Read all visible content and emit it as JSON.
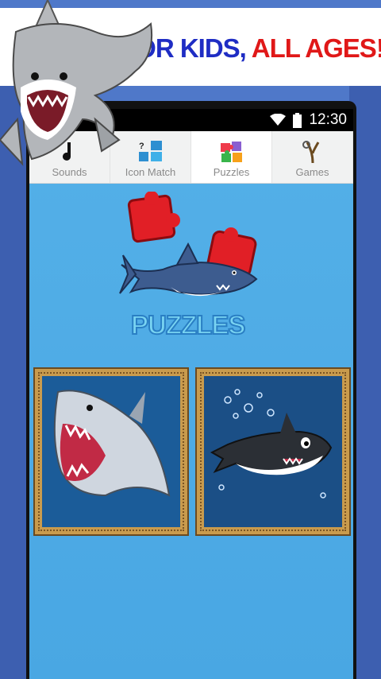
{
  "banner": {
    "headline_part1": "FOR KIDS,",
    "headline_part2": "ALL AGES!",
    "colors": {
      "part1": "#1f2dc4",
      "part2": "#e01818"
    }
  },
  "status_bar": {
    "time": "12:30",
    "icons": [
      "wifi-icon",
      "battery-icon"
    ]
  },
  "tabs": [
    {
      "label": "Sounds",
      "icon": "music-note-icon",
      "active": false
    },
    {
      "label": "Icon Match",
      "icon": "icon-match-icon",
      "active": false
    },
    {
      "label": "Puzzles",
      "icon": "puzzle-pieces-icon",
      "active": true
    },
    {
      "label": "Games",
      "icon": "slingshot-icon",
      "active": false
    }
  ],
  "logo": {
    "text": "PUZZLES"
  },
  "puzzles": [
    {
      "name": "Open-mouth shark puzzle"
    },
    {
      "name": "Smiling shark puzzle"
    }
  ]
}
